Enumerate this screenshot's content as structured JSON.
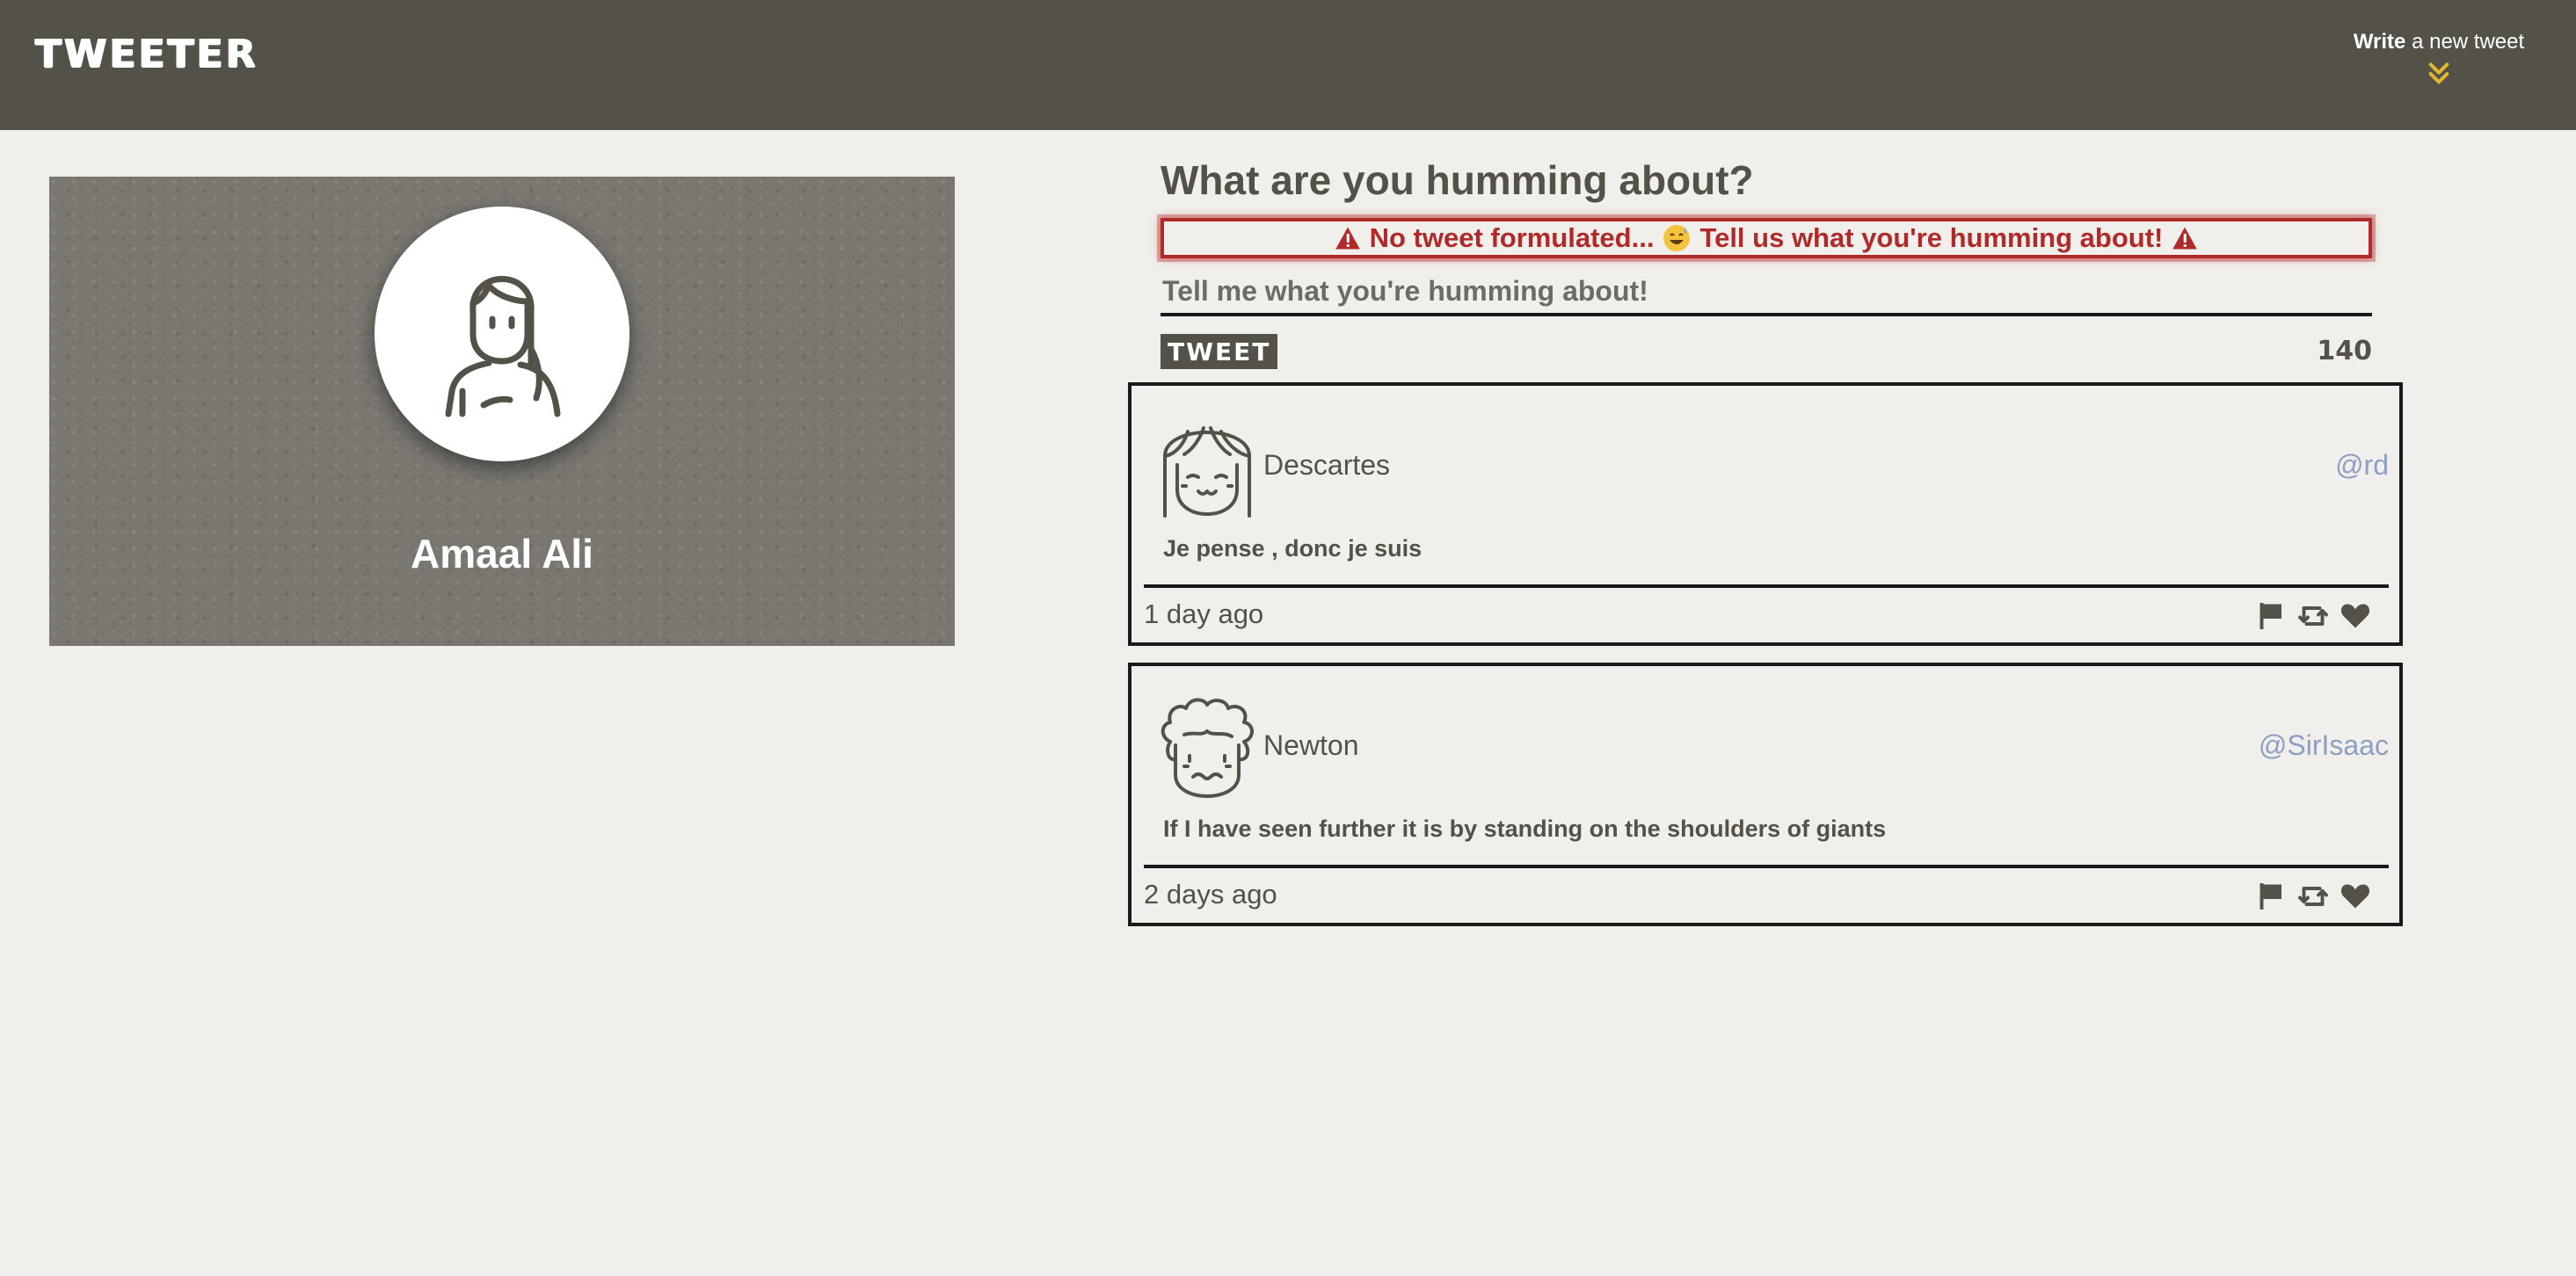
{
  "nav": {
    "brand": "TWEETER",
    "compose_bold": "Write",
    "compose_rest": " a new tweet"
  },
  "profile": {
    "name": "Amaal Ali"
  },
  "composer": {
    "heading": "What are you humming about?",
    "error_part1": "No tweet formulated...",
    "error_part2": "Tell us what you're humming about!",
    "placeholder": "Tell me what you're humming about!",
    "button": "TWEET",
    "counter": "140"
  },
  "tweets": [
    {
      "name": "Descartes",
      "handle": "@rd",
      "body": "Je pense , donc je suis",
      "time": "1 day ago"
    },
    {
      "name": "Newton",
      "handle": "@SirIsaac",
      "body": "If I have seen further it is by standing on the shoulders of giants",
      "time": "2 days ago"
    }
  ],
  "colors": {
    "nav_bg": "#545149",
    "page_bg": "#f1efeb",
    "error": "#b02a2a",
    "handle": "#8da0c4",
    "accent": "#e0b72e"
  },
  "icons": [
    "double-chevron-down-icon",
    "warning-icon",
    "grinning-sweat-emoji-icon",
    "flag-icon",
    "retweet-icon",
    "heart-icon"
  ]
}
